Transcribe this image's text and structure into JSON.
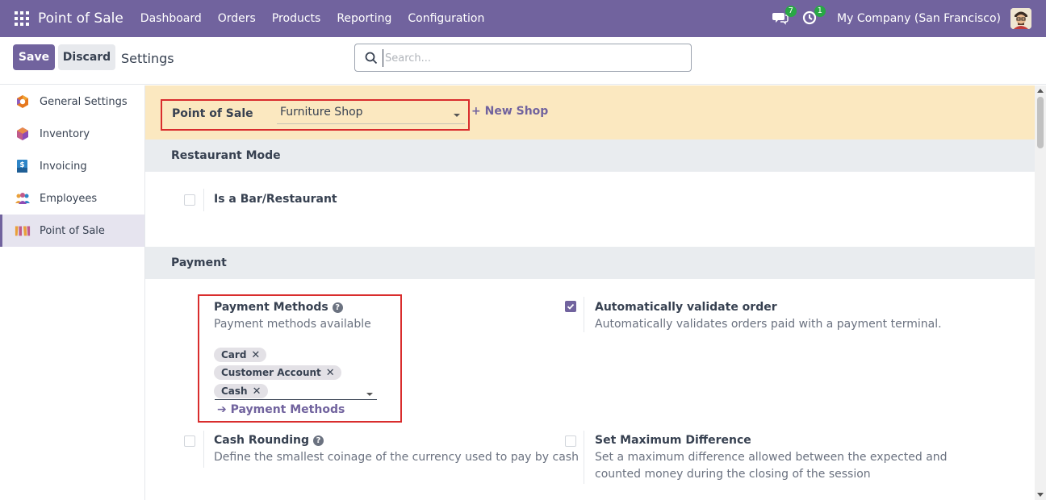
{
  "navbar": {
    "brand": "Point of Sale",
    "menu": [
      "Dashboard",
      "Orders",
      "Products",
      "Reporting",
      "Configuration"
    ],
    "messages_count": "7",
    "activities_count": "1",
    "company": "My Company (San Francisco)"
  },
  "control_panel": {
    "save_label": "Save",
    "discard_label": "Discard",
    "title": "Settings",
    "search_placeholder": "Search..."
  },
  "sidebar": {
    "items": [
      {
        "label": "General Settings",
        "icon": "odoo-logo-icon"
      },
      {
        "label": "Inventory",
        "icon": "inventory-box-icon"
      },
      {
        "label": "Invoicing",
        "icon": "invoice-icon"
      },
      {
        "label": "Employees",
        "icon": "employees-icon"
      },
      {
        "label": "Point of Sale",
        "icon": "shop-awning-icon",
        "active": true
      }
    ]
  },
  "pos_banner": {
    "label": "Point of Sale",
    "selected_shop": "Furniture Shop",
    "new_shop_label": "+ New Shop"
  },
  "restaurant_section": {
    "title": "Restaurant Mode",
    "is_bar_label": "Is a Bar/Restaurant",
    "is_bar_checked": false
  },
  "payment_section": {
    "title": "Payment",
    "payment_methods": {
      "title": "Payment Methods",
      "description": "Payment methods available",
      "tags": [
        "Card",
        "Customer Account",
        "Cash"
      ],
      "link_label": "Payment Methods"
    },
    "auto_validate": {
      "title": "Automatically validate order",
      "description": "Automatically validates orders paid with a payment terminal.",
      "checked": true
    },
    "cash_rounding": {
      "title": "Cash Rounding",
      "description": "Define the smallest coinage of the currency used to pay by cash",
      "checked": false
    },
    "max_difference": {
      "title": "Set Maximum Difference",
      "description_line1": "Set a maximum difference allowed between the expected and",
      "description_line2": "counted money during the closing of the session",
      "checked": false
    }
  },
  "colors": {
    "brand": "#71639e",
    "banner": "#fbe8c0",
    "highlight_border": "#d92d2d",
    "badge": "#28a745"
  }
}
